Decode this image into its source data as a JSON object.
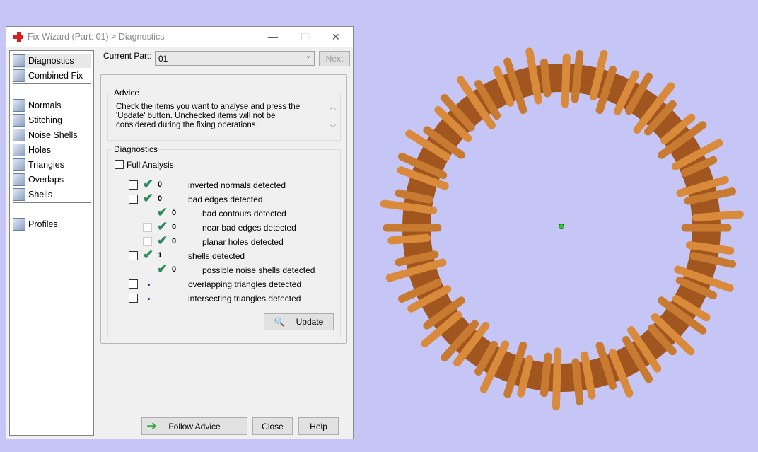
{
  "window": {
    "title": "Fix Wizard (Part: 01) > Diagnostics",
    "minimize": "—",
    "maximize": "☐",
    "close": "✕"
  },
  "sidebar": {
    "items": [
      {
        "label": "Diagnostics",
        "icon": "magnifier-icon"
      },
      {
        "label": "Combined Fix",
        "icon": "combined-fix-icon"
      },
      {
        "label": "Normals",
        "icon": "normals-icon"
      },
      {
        "label": "Stitching",
        "icon": "stitching-icon"
      },
      {
        "label": "Noise Shells",
        "icon": "noise-shells-icon"
      },
      {
        "label": "Holes",
        "icon": "holes-icon"
      },
      {
        "label": "Triangles",
        "icon": "triangles-icon"
      },
      {
        "label": "Overlaps",
        "icon": "overlaps-icon"
      },
      {
        "label": "Shells",
        "icon": "shells-icon"
      },
      {
        "label": "Profiles",
        "icon": "profiles-icon"
      }
    ]
  },
  "current_part": {
    "label": "Current Part:",
    "value": "01",
    "next": "Next"
  },
  "advice": {
    "title": "Advice",
    "text": "Check the items you want to analyse and press the 'Update' button. Unchecked items will not be considered during the fixing operations."
  },
  "diagnostics": {
    "title": "Diagnostics",
    "full_analysis": "Full Analysis",
    "rows": [
      {
        "value": "0",
        "label": "inverted normals detected",
        "status": "ok"
      },
      {
        "value": "0",
        "label": "bad edges detected",
        "status": "ok"
      },
      {
        "value": "0",
        "label": "bad contours detected",
        "status": "ok"
      },
      {
        "value": "0",
        "label": "near bad edges detected",
        "status": "ok"
      },
      {
        "value": "0",
        "label": "planar holes detected",
        "status": "ok"
      },
      {
        "value": "1",
        "label": "shells detected",
        "status": "ok"
      },
      {
        "value": "0",
        "label": "possible noise shells detected",
        "status": "ok"
      },
      {
        "value": "",
        "label": "overlapping triangles detected",
        "status": "pending"
      },
      {
        "value": "",
        "label": "intersecting triangles detected",
        "status": "pending"
      }
    ],
    "update": "Update"
  },
  "footer": {
    "follow": "Follow Advice",
    "close": "Close",
    "help": "Help"
  },
  "colors": {
    "background": "#c6c6f6",
    "model": "#d98a3a",
    "check": "#2e8b57"
  }
}
